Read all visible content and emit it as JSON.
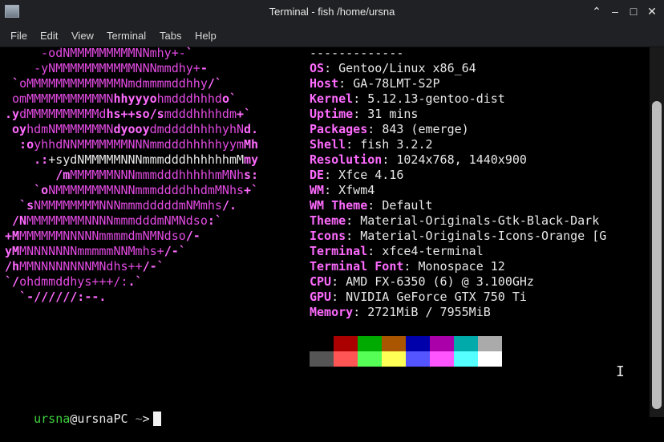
{
  "window": {
    "title": "Terminal - fish /home/ursna"
  },
  "menu": [
    "File",
    "Edit",
    "View",
    "Terminal",
    "Tabs",
    "Help"
  ],
  "logo": [
    {
      "parts": [
        {
          "t": "     -odNMMMMMMMMMNNmhy+-",
          "c": "mag"
        },
        {
          "t": "`",
          "c": "pink"
        }
      ]
    },
    {
      "parts": [
        {
          "t": "    -yNMMMMMMMMMMMNNNmmdhy+",
          "c": "mag"
        },
        {
          "t": "-",
          "c": "pink"
        }
      ]
    },
    {
      "parts": [
        {
          "t": " `",
          "c": "pink"
        },
        {
          "t": "oMMMMMMMMMMMMMNmdmmmmddhhy",
          "c": "mag"
        },
        {
          "t": "/`",
          "c": "pink"
        }
      ]
    },
    {
      "parts": [
        {
          "t": " omMMMMMMMMMMMN",
          "c": "mag"
        },
        {
          "t": "hhyyyo",
          "c": "pink"
        },
        {
          "t": "hmdddhhhd",
          "c": "mag"
        },
        {
          "t": "o`",
          "c": "pink"
        }
      ]
    },
    {
      "parts": [
        {
          "t": ".y",
          "c": "pink"
        },
        {
          "t": "dMMMMMMMMMMd",
          "c": "mag"
        },
        {
          "t": "hs++so/s",
          "c": "pink"
        },
        {
          "t": "mdddhhhhdm",
          "c": "mag"
        },
        {
          "t": "+`",
          "c": "pink"
        }
      ]
    },
    {
      "parts": [
        {
          "t": " oy",
          "c": "pink"
        },
        {
          "t": "hdmNMMMMMMMN",
          "c": "mag"
        },
        {
          "t": "dyooy",
          "c": "pink"
        },
        {
          "t": "dmddddhhhhyhN",
          "c": "mag"
        },
        {
          "t": "d.",
          "c": "pink"
        }
      ]
    },
    {
      "parts": [
        {
          "t": "  :o",
          "c": "pink"
        },
        {
          "t": "yhhdNNMMMMMMMNNNmmdddhhhhhyym",
          "c": "mag"
        },
        {
          "t": "Mh",
          "c": "pink"
        }
      ]
    },
    {
      "parts": [
        {
          "t": "    .:",
          "c": "pink"
        },
        {
          "t": "+sydNMMMMMNNNmmmdddhhhhhhmM",
          "c": "wht"
        },
        {
          "t": "my",
          "c": "pink"
        }
      ]
    },
    {
      "parts": [
        {
          "t": "       /m",
          "c": "pink"
        },
        {
          "t": "MMMMMMNNNmmmdddhhhhhmMNh",
          "c": "mag"
        },
        {
          "t": "s:",
          "c": "pink"
        }
      ]
    },
    {
      "parts": [
        {
          "t": "    `o",
          "c": "pink"
        },
        {
          "t": "NMMMMMMMMNNNmmmddddhhdmMNhs",
          "c": "mag"
        },
        {
          "t": "+`",
          "c": "pink"
        }
      ]
    },
    {
      "parts": [
        {
          "t": "  `s",
          "c": "pink"
        },
        {
          "t": "NMMMMMMMMNNNmmmdddddmNMmhs",
          "c": "mag"
        },
        {
          "t": "/.",
          "c": "pink"
        }
      ]
    },
    {
      "parts": [
        {
          "t": " /N",
          "c": "pink"
        },
        {
          "t": "MMMMMMMMNNNNmmmdddmNMNdso",
          "c": "mag"
        },
        {
          "t": ":`",
          "c": "pink"
        }
      ]
    },
    {
      "parts": [
        {
          "t": "+M",
          "c": "pink"
        },
        {
          "t": "MMMMMMNNNNNmmmmdmNMNdso",
          "c": "mag"
        },
        {
          "t": "/-",
          "c": "pink"
        }
      ]
    },
    {
      "parts": [
        {
          "t": "yM",
          "c": "pink"
        },
        {
          "t": "MNNNNNNNmmmmmNNMmhs+",
          "c": "mag"
        },
        {
          "t": "/-`",
          "c": "pink"
        }
      ]
    },
    {
      "parts": [
        {
          "t": "/h",
          "c": "pink"
        },
        {
          "t": "MMNNNNNNNNMNdhs++",
          "c": "mag"
        },
        {
          "t": "/-`",
          "c": "pink"
        }
      ]
    },
    {
      "parts": [
        {
          "t": "`/",
          "c": "pink"
        },
        {
          "t": "ohdmmddhys+++/:",
          "c": "mag"
        },
        {
          "t": ".`",
          "c": "pink"
        }
      ]
    },
    {
      "parts": [
        {
          "t": "  `-//////:--.",
          "c": "pink"
        }
      ]
    }
  ],
  "info": {
    "separator": "-------------",
    "rows": [
      {
        "label": "OS",
        "value": "Gentoo/Linux x86_64"
      },
      {
        "label": "Host",
        "value": "GA-78LMT-S2P"
      },
      {
        "label": "Kernel",
        "value": "5.12.13-gentoo-dist"
      },
      {
        "label": "Uptime",
        "value": "31 mins"
      },
      {
        "label": "Packages",
        "value": "843 (emerge)"
      },
      {
        "label": "Shell",
        "value": "fish 3.2.2"
      },
      {
        "label": "Resolution",
        "value": "1024x768, 1440x900"
      },
      {
        "label": "DE",
        "value": "Xfce 4.16"
      },
      {
        "label": "WM",
        "value": "Xfwm4"
      },
      {
        "label": "WM Theme",
        "value": "Default"
      },
      {
        "label": "Theme",
        "value": "Material-Originals-Gtk-Black-Dark"
      },
      {
        "label": "Icons",
        "value": "Material-Originals-Icons-Orange [G"
      },
      {
        "label": "Terminal",
        "value": "xfce4-terminal"
      },
      {
        "label": "Terminal Font",
        "value": "Monospace 12"
      },
      {
        "label": "CPU",
        "value": "AMD FX-6350 (6) @ 3.100GHz"
      },
      {
        "label": "GPU",
        "value": "NVIDIA GeForce GTX 750 Ti"
      },
      {
        "label": "Memory",
        "value": "2721MiB / 7955MiB"
      }
    ]
  },
  "palette": {
    "top": [
      "#000000",
      "#aa0000",
      "#00aa00",
      "#aa5500",
      "#0000aa",
      "#aa00aa",
      "#00aaaa",
      "#aaaaaa"
    ],
    "bottom": [
      "#555555",
      "#ff5555",
      "#55ff55",
      "#ffff55",
      "#5555ff",
      "#ff55ff",
      "#55ffff",
      "#ffffff"
    ]
  },
  "prompt": {
    "user": "ursna",
    "at": "@",
    "host": "ursnaPC",
    "cwd": "~",
    "arrow": ">"
  }
}
